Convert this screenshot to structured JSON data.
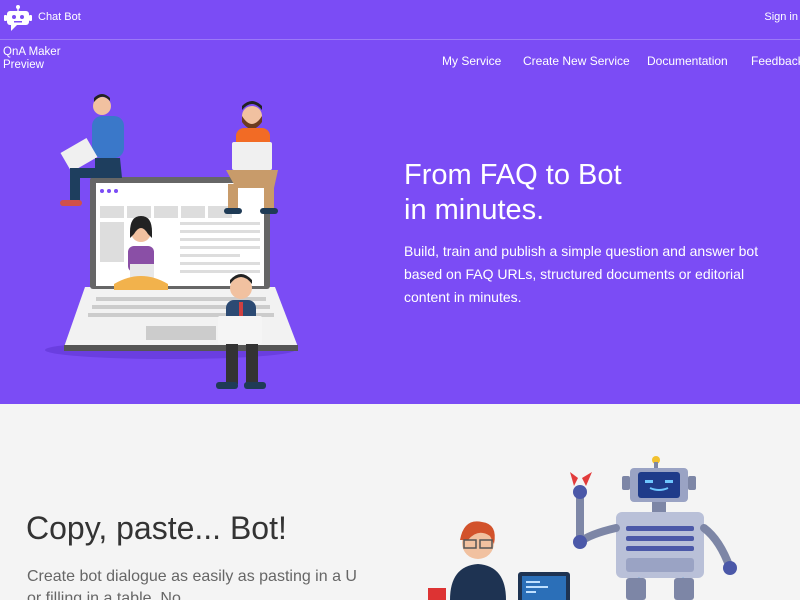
{
  "header": {
    "brand": "Chat Bot",
    "product_line1": "QnA Maker",
    "product_line2": "Preview",
    "sign_in": "Sign in",
    "nav": [
      "My Service",
      "Create New Service",
      "Documentation",
      "Feedback"
    ]
  },
  "hero": {
    "title_line1": "From FAQ to Bot",
    "title_line2": "in minutes.",
    "subtitle_line1": "Build, train and publish a simple question and answer bot",
    "subtitle_line2": "based on FAQ URLs, structured documents or editorial",
    "subtitle_line3": "content in minutes."
  },
  "section2": {
    "title": "Copy, paste... Bot!",
    "subtitle_line1": "Create bot dialogue as easily as pasting in a URL",
    "subtitle_line2": "or filling in a table. No"
  },
  "colors": {
    "hero_bg": "#7b4cf5",
    "section_bg": "#f4f4f4"
  },
  "icons": {
    "logo": "chatbot-icon"
  }
}
